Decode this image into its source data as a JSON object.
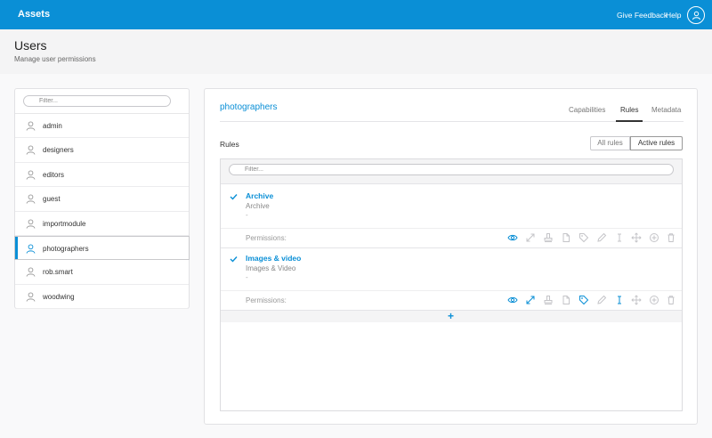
{
  "topbar": {
    "brand": "Assets",
    "feedback": "Give Feedback",
    "help": "Help",
    "profile_icon": "user-circle-icon",
    "colors": {
      "brand": "#0a8fd6"
    }
  },
  "header": {
    "title": "Users",
    "subtitle": "Manage user permissions"
  },
  "sidebar": {
    "filter_placeholder": "Filter...",
    "selected": "photographers",
    "users": [
      {
        "name": "admin"
      },
      {
        "name": "designers"
      },
      {
        "name": "editors"
      },
      {
        "name": "guest"
      },
      {
        "name": "importmodule"
      },
      {
        "name": "photographers"
      },
      {
        "name": "rob.smart"
      },
      {
        "name": "woodwing"
      }
    ]
  },
  "main": {
    "group_name": "photographers",
    "tabs": [
      {
        "label": "Capabilities"
      },
      {
        "label": "Rules",
        "active": true
      },
      {
        "label": "Metadata"
      }
    ],
    "rules_heading": "Rules",
    "toggle": {
      "all": "All rules",
      "active": "Active rules",
      "selected": "Active rules"
    },
    "rules_filter_placeholder": "Filter...",
    "rules": [
      {
        "name": "Archive",
        "description": "Archive",
        "extra": "-",
        "permissions_label": "Permissions:",
        "enabled": [
          true,
          false,
          false,
          false,
          false,
          false,
          false,
          false,
          false,
          false
        ]
      },
      {
        "name": "Images & video",
        "description": "Images & Video",
        "extra": "-",
        "permissions_label": "Permissions:",
        "enabled": [
          true,
          true,
          false,
          false,
          true,
          false,
          true,
          false,
          false,
          false
        ]
      }
    ],
    "permission_icons": [
      "eye-icon",
      "expand-icon",
      "stamp-icon",
      "file-icon",
      "tag-icon",
      "pencil-icon",
      "resize-vertical-icon",
      "move-icon",
      "plus-circle-icon",
      "trash-icon"
    ],
    "add_label": "+"
  }
}
